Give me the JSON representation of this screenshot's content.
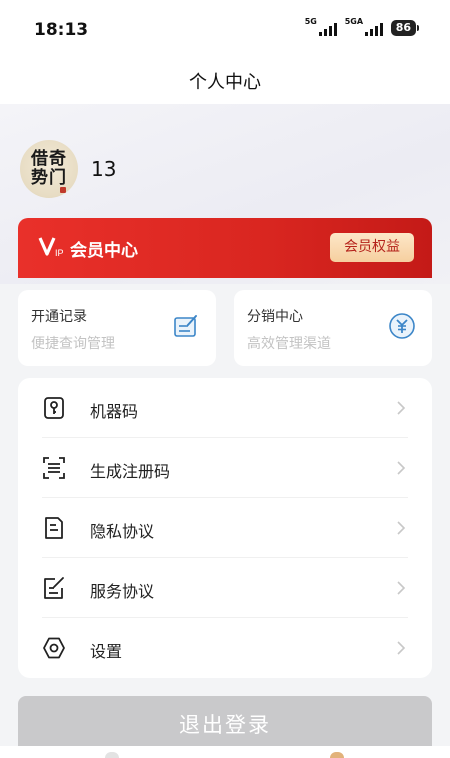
{
  "status_bar": {
    "time": "18:13",
    "net1": "5G",
    "net2": "5GA",
    "battery": "86"
  },
  "nav": {
    "title": "个人中心"
  },
  "profile": {
    "avatar_text_line1": "借奇",
    "avatar_text_line2": "势门",
    "username": "13"
  },
  "vip": {
    "title": "会员中心",
    "benefit_button": "会员权益"
  },
  "quick_actions": [
    {
      "title": "开通记录",
      "subtitle": "便捷查询管理",
      "icon": "edit-list-icon"
    },
    {
      "title": "分销中心",
      "subtitle": "高效管理渠道",
      "icon": "yuan-icon"
    }
  ],
  "menu": [
    {
      "label": "机器码",
      "icon": "key-icon"
    },
    {
      "label": "生成注册码",
      "icon": "scan-code-icon"
    },
    {
      "label": "隐私协议",
      "icon": "document-icon"
    },
    {
      "label": "服务协议",
      "icon": "edit-document-icon"
    },
    {
      "label": "设置",
      "icon": "settings-icon"
    }
  ],
  "logout": {
    "label": "退出登录"
  },
  "colors": {
    "vip_red": "#d92620",
    "accent_blue": "#3c86c8",
    "logout_gray": "#c9c9cb"
  }
}
